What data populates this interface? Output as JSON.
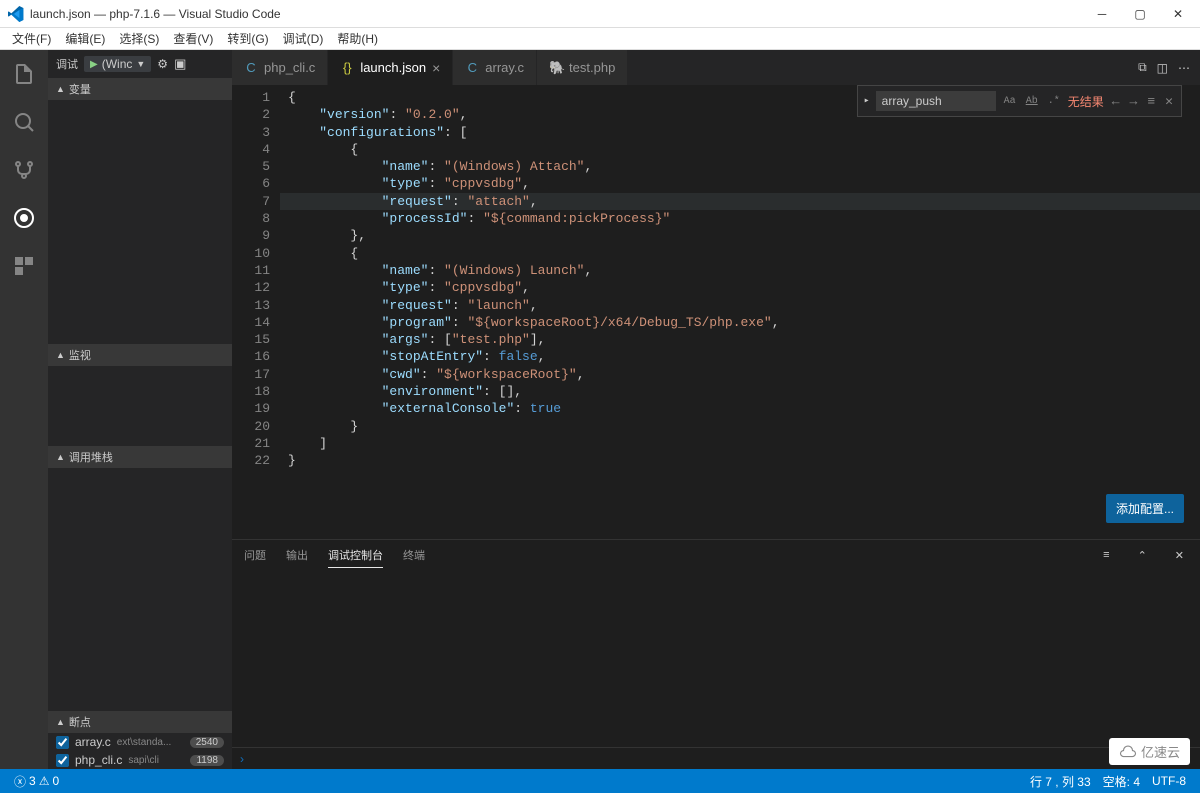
{
  "window": {
    "title": "launch.json — php-7.1.6 — Visual Studio Code"
  },
  "menu": [
    "文件(F)",
    "编辑(E)",
    "选择(S)",
    "查看(V)",
    "转到(G)",
    "调试(D)",
    "帮助(H)"
  ],
  "debug_toolbar": {
    "label": "调试",
    "config": "(Winc"
  },
  "sidebar": {
    "variables": "变量",
    "watch": "监视",
    "callstack": "调用堆栈",
    "breakpoints": "断点",
    "bp_items": [
      {
        "file": "array.c",
        "path": "ext\\standa...",
        "line": "2540"
      },
      {
        "file": "php_cli.c",
        "path": "sapi\\cli",
        "line": "1198"
      }
    ]
  },
  "tabs": [
    {
      "icon": "C",
      "icon_color": "#519aba",
      "label": "php_cli.c",
      "active": false
    },
    {
      "icon": "{}",
      "icon_color": "#cbcb41",
      "label": "launch.json",
      "active": true
    },
    {
      "icon": "C",
      "icon_color": "#519aba",
      "label": "array.c",
      "active": false
    },
    {
      "icon": "🐘",
      "icon_color": "#a074c4",
      "label": "test.php",
      "active": false
    }
  ],
  "find": {
    "value": "array_push",
    "no_results": "无结果"
  },
  "code_lines": [
    "{",
    "    \"version\": \"0.2.0\",",
    "    \"configurations\": [",
    "        {",
    "            \"name\": \"(Windows) Attach\",",
    "            \"type\": \"cppvsdbg\",",
    "            \"request\": \"attach\",",
    "            \"processId\": \"${command:pickProcess}\"",
    "        },",
    "        {",
    "            \"name\": \"(Windows) Launch\",",
    "            \"type\": \"cppvsdbg\",",
    "            \"request\": \"launch\",",
    "            \"program\": \"${workspaceRoot}/x64/Debug_TS/php.exe\",",
    "            \"args\": [\"test.php\"],",
    "            \"stopAtEntry\": false,",
    "            \"cwd\": \"${workspaceRoot}\",",
    "            \"environment\": [],",
    "            \"externalConsole\": true",
    "        }",
    "    ]",
    "}"
  ],
  "add_config": "添加配置...",
  "panel": {
    "tabs": [
      "问题",
      "输出",
      "调试控制台",
      "终端"
    ],
    "active": 2
  },
  "status": {
    "errors": "3",
    "warnings": "0",
    "ln_col": "行 7 , 列 33",
    "spaces": "空格: 4",
    "encoding": "UTF-8"
  },
  "watermark": "亿速云"
}
